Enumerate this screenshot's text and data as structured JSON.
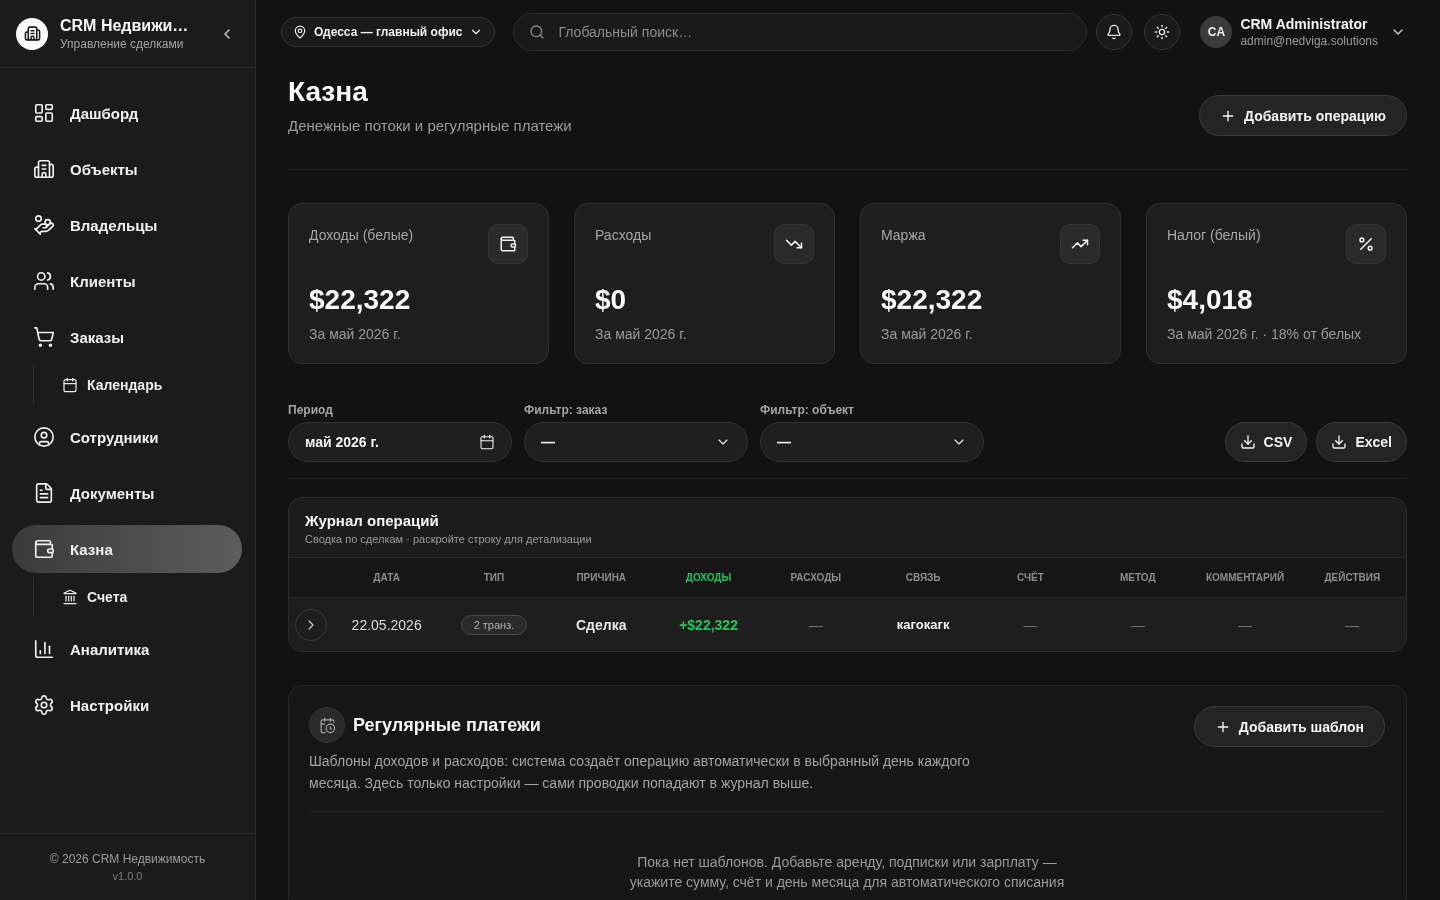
{
  "sidebar": {
    "brand": {
      "title": "CRM Недвижи…",
      "subtitle": "Управление сделками"
    },
    "items": [
      {
        "label": "Дашборд",
        "selected": false
      },
      {
        "label": "Объекты",
        "selected": false
      },
      {
        "label": "Владельцы",
        "selected": false
      },
      {
        "label": "Клиенты",
        "selected": false
      },
      {
        "label": "Заказы",
        "selected": false,
        "children": [
          {
            "label": "Календарь",
            "selected": false
          }
        ]
      },
      {
        "label": "Сотрудники",
        "selected": false
      },
      {
        "label": "Документы",
        "selected": false
      },
      {
        "label": "Казна",
        "selected": true,
        "children": [
          {
            "label": "Счета",
            "selected": false
          }
        ]
      },
      {
        "label": "Аналитика",
        "selected": false
      },
      {
        "label": "Настройки",
        "selected": false
      }
    ],
    "footer": {
      "copyright": "© 2026 CRM Недвижимость",
      "version": "v1.0.0"
    }
  },
  "topbar": {
    "office": "Одесса — главный офис",
    "search": {
      "placeholder": "Глобальный поиск…"
    },
    "user": {
      "initials": "CA",
      "name": "CRM Administrator",
      "email": "admin@nedviga.solutions"
    }
  },
  "page": {
    "title": "Казна",
    "subtitle": "Денежные потоки и регулярные платежи",
    "primary_action": "Добавить операцию"
  },
  "stats": [
    {
      "label": "Доходы (белые)",
      "value": "$22,322",
      "note": "За май 2026 г."
    },
    {
      "label": "Расходы",
      "value": "$0",
      "note": "За май 2026 г."
    },
    {
      "label": "Маржа",
      "value": "$22,322",
      "note": "За май 2026 г."
    },
    {
      "label": "Налог (белый)",
      "value": "$4,018",
      "note": "За май 2026 г. · 18% от белых"
    }
  ],
  "filters": [
    {
      "kind": "date",
      "label": "Период",
      "value": "май 2026 г."
    },
    {
      "kind": "select",
      "label": "Фильтр: заказ",
      "value": "—"
    },
    {
      "kind": "select",
      "label": "Фильтр: объект",
      "value": "—"
    }
  ],
  "exports": [
    "CSV",
    "Excel"
  ],
  "journal": {
    "title": "Журнал операций",
    "subtitle": "Сводка по сделкам · раскройте строку для детализации",
    "columns": [
      {
        "label": "ДАТА",
        "color": "#8c8c8c"
      },
      {
        "label": "ТИП",
        "color": "#8c8c8c"
      },
      {
        "label": "ПРИЧИНА",
        "color": "#8c8c8c"
      },
      {
        "label": "ДОХОДЫ",
        "color": "#22c55e"
      },
      {
        "label": "РАСХОДЫ",
        "color": "#8c8c8c"
      },
      {
        "label": "СВЯЗЬ",
        "color": "#8c8c8c"
      },
      {
        "label": "СЧЁТ",
        "color": "#8c8c8c"
      },
      {
        "label": "МЕТОД",
        "color": "#8c8c8c"
      },
      {
        "label": "КОММЕНТАРИЙ",
        "color": "#8c8c8c"
      },
      {
        "label": "ДЕЙСТВИЯ",
        "color": "#8c8c8c"
      }
    ],
    "rows": [
      {
        "expanded": false,
        "date": "22.05.2026",
        "type": "2 транз.",
        "reason": "Сделка",
        "income": "+$22,322",
        "expense": "—",
        "link": "кагокагк",
        "account": "—",
        "method": "—",
        "comment": "—",
        "actions": "—"
      }
    ]
  },
  "recurring": {
    "title": "Регулярные платежи",
    "action": "Добавить шаблон",
    "description": "Шаблоны доходов и расходов: система создаёт операцию автоматически в выбранный день каждого месяца. Здесь только настройки — сами проводки попадают в журнал выше.",
    "empty": "Пока нет шаблонов. Добавьте аренду, подписки или зарплату — укажите сумму, счёт и день месяца для автоматического списания"
  }
}
